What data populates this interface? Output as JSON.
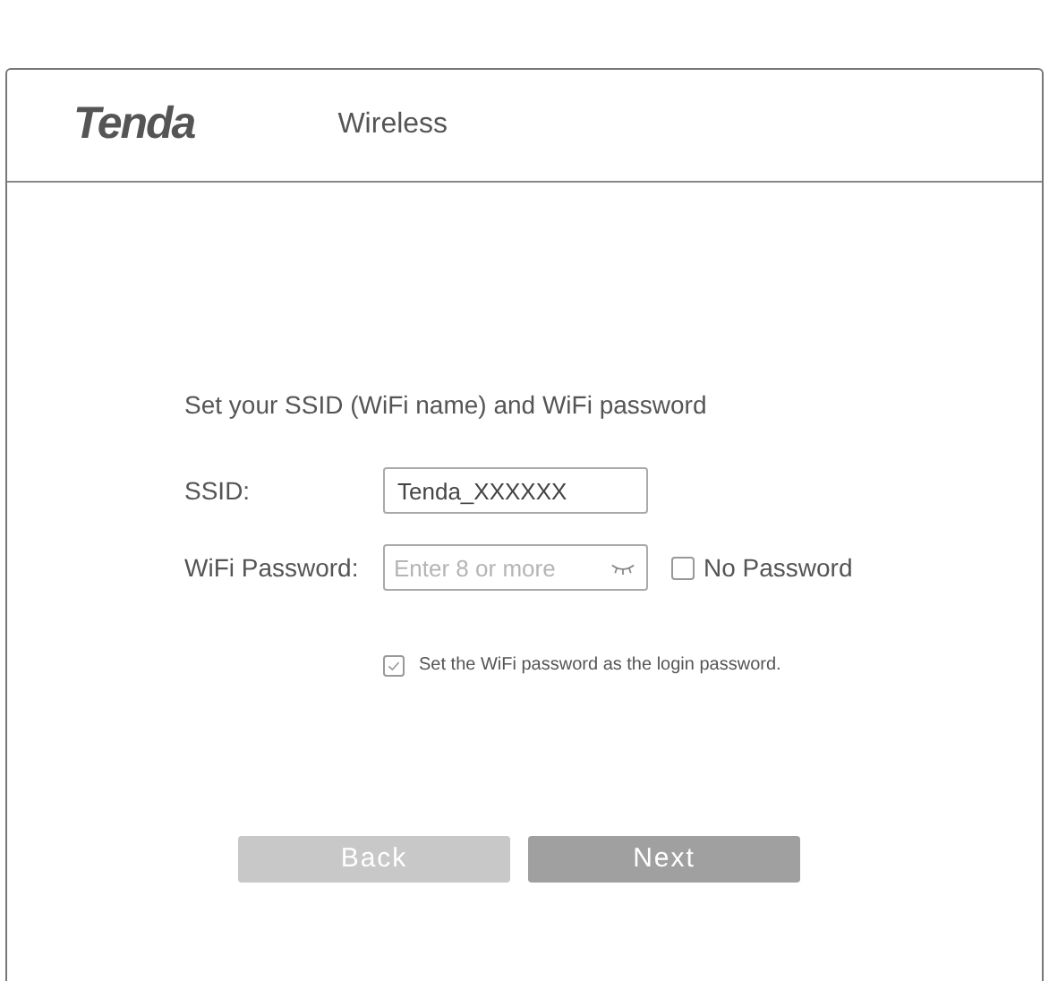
{
  "header": {
    "logo": "Tenda",
    "title": "Wireless"
  },
  "form": {
    "heading": "Set your SSID (WiFi name) and WiFi password",
    "ssid": {
      "label": "SSID:",
      "value": "Tenda_XXXXXX"
    },
    "password": {
      "label": "WiFi Password:",
      "placeholder": "Enter 8 or more",
      "no_password": {
        "label": "No Password",
        "checked": false
      }
    },
    "login_option": {
      "label": "Set the WiFi password as the login password.",
      "checked": true
    }
  },
  "buttons": [
    {
      "label": "Back",
      "kind": "secondary"
    },
    {
      "label": "Next",
      "kind": "primary"
    }
  ]
}
